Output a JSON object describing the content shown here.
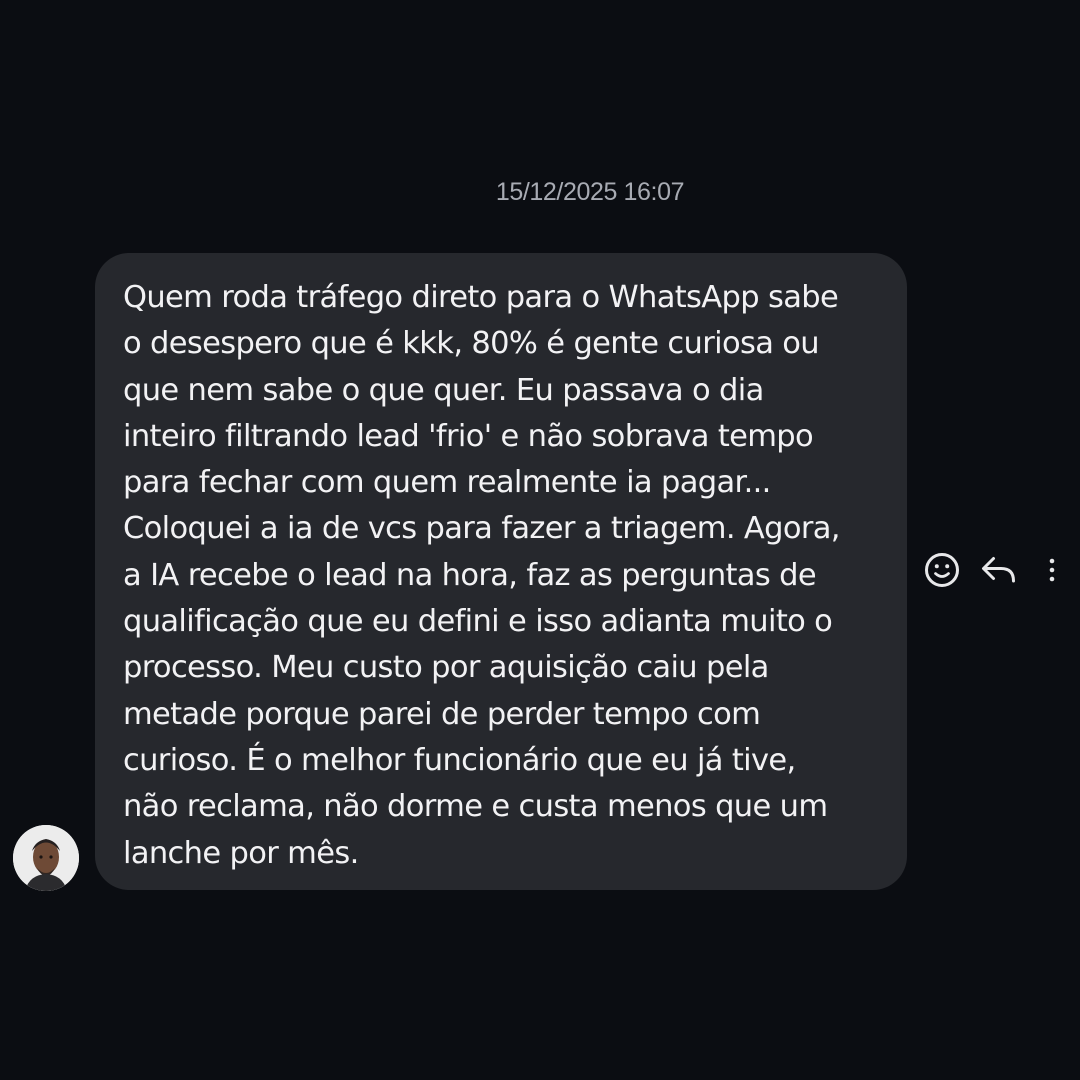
{
  "conversation": {
    "timestamp": "15/12/2025 16:07",
    "message": {
      "text": "Quem roda tráfego direto para o WhatsApp sabe\no desespero que é kkk, 80% é gente curiosa ou\nque nem sabe o que quer. Eu passava o dia\ninteiro filtrando lead 'frio' e não sobrava tempo\npara fechar com quem realmente ia pagar...\nColoquei a ia de vcs para fazer a triagem. Agora,\na IA recebe o lead na hora, faz as perguntas de\nqualificação que eu defini e isso adianta muito o\nprocesso. Meu custo por aquisição caiu pela\nmetade porque parei de perder tempo com\ncurioso. É o melhor funcionário que eu já tive,\nnão reclama, não dorme e custa menos que um\nlanche por mês."
    },
    "actions": [
      {
        "icon": "smiley-icon"
      },
      {
        "icon": "reply-icon"
      },
      {
        "icon": "more-vertical-icon"
      }
    ]
  },
  "colors": {
    "background": "#0b0d12",
    "bubble": "#26282d",
    "text": "#f2f2f4",
    "timestamp": "#a8abb3",
    "icons": "#e8e8ea"
  }
}
